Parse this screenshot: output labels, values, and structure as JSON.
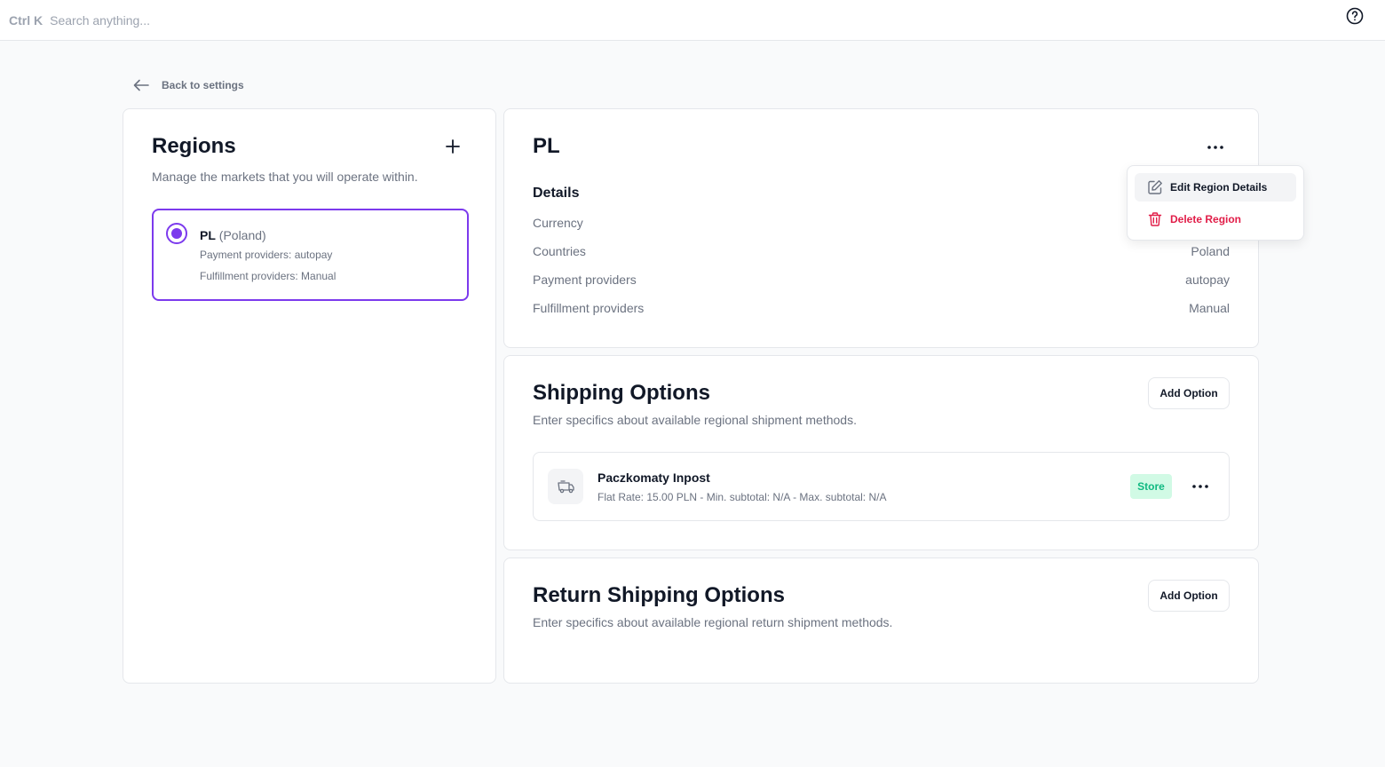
{
  "topbar": {
    "shortcut": "Ctrl K",
    "search_placeholder": "Search anything..."
  },
  "back_link": "Back to settings",
  "regions": {
    "title": "Regions",
    "subtitle": "Manage the markets that you will operate within.",
    "items": [
      {
        "code": "PL",
        "name": "(Poland)",
        "payment": "Payment providers: autopay",
        "fulfillment": "Fulfillment providers: Manual",
        "selected": true
      }
    ]
  },
  "region_detail": {
    "title": "PL",
    "details_heading": "Details",
    "rows": [
      {
        "label": "Currency",
        "value": ""
      },
      {
        "label": "Countries",
        "value": "Poland"
      },
      {
        "label": "Payment providers",
        "value": "autopay"
      },
      {
        "label": "Fulfillment providers",
        "value": "Manual"
      }
    ],
    "menu": {
      "edit": "Edit Region Details",
      "delete": "Delete Region"
    }
  },
  "shipping": {
    "title": "Shipping Options",
    "subtitle": "Enter specifics about available regional shipment methods.",
    "add_label": "Add Option",
    "options": [
      {
        "name": "Paczkomaty Inpost",
        "desc": "Flat Rate: 15.00 PLN - Min. subtotal: N/A - Max. subtotal: N/A",
        "badge": "Store"
      }
    ]
  },
  "returns": {
    "title": "Return Shipping Options",
    "subtitle": "Enter specifics about available regional return shipment methods.",
    "add_label": "Add Option"
  },
  "colors": {
    "accent": "#7c3aed",
    "danger": "#e11d48",
    "success_bg": "#d1fae5",
    "success_text": "#10b981"
  }
}
